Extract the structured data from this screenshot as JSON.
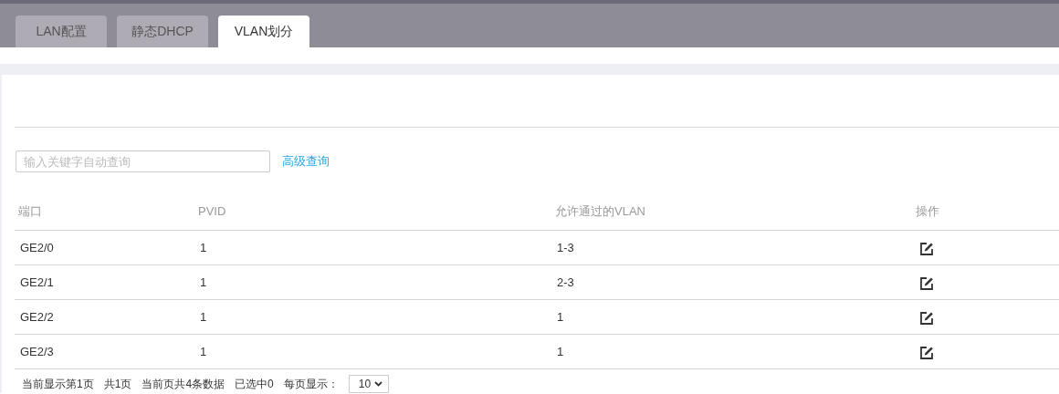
{
  "tabs": [
    {
      "label": "LAN配置",
      "selected": false
    },
    {
      "label": "静态DHCP",
      "selected": false
    },
    {
      "label": "VLAN划分",
      "selected": true
    }
  ],
  "search": {
    "placeholder": "输入关键字自动查询"
  },
  "advanced_search": "高级查询",
  "table": {
    "columns": [
      "端口",
      "PVID",
      "允许通过的VLAN",
      "操作"
    ],
    "rows": [
      [
        "GE2/0",
        "1",
        "1-3"
      ],
      [
        "GE2/1",
        "1",
        "2-3"
      ],
      [
        "GE2/2",
        "1",
        "1"
      ],
      [
        "GE2/3",
        "1",
        "1"
      ]
    ]
  },
  "footer": {
    "texts": [
      "当前显示第1页",
      "共1页",
      "当前页共4条数据",
      "已选中0",
      "每页显示："
    ],
    "page_size": "10"
  }
}
